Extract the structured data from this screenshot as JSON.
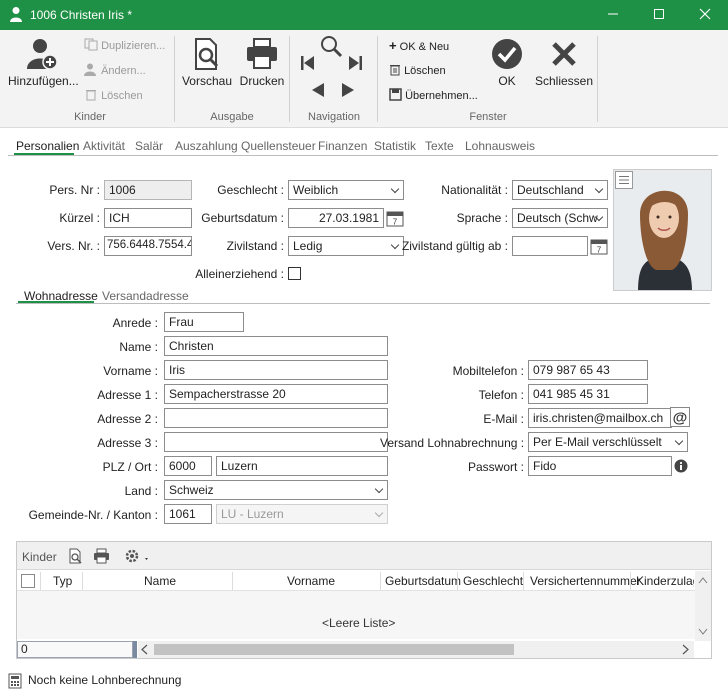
{
  "window": {
    "title": "1006 Christen Iris *"
  },
  "ribbon": {
    "kinder": {
      "add": "Hinzufügen...",
      "duplicate": "Duplizieren...",
      "change": "Ändern...",
      "delete": "Löschen",
      "group": "Kinder"
    },
    "ausgabe": {
      "preview": "Vorschau",
      "print": "Drucken",
      "group": "Ausgabe"
    },
    "navigation": {
      "group": "Navigation"
    },
    "fenster": {
      "ok_new": "OK & Neu",
      "delete": "Löschen",
      "apply": "Übernehmen...",
      "ok": "OK",
      "close": "Schliessen",
      "group": "Fenster"
    }
  },
  "tabs": [
    "Personalien",
    "Aktivität",
    "Salär",
    "Auszahlung",
    "Quellensteuer",
    "Finanzen",
    "Statistik",
    "Texte",
    "Lohnausweis"
  ],
  "personalien": {
    "pers_nr_label": "Pers. Nr :",
    "pers_nr": "1006",
    "kuerzel_label": "Kürzel :",
    "kuerzel": "ICH",
    "vers_nr_label": "Vers. Nr. :",
    "vers_nr": "756.6448.7554.4",
    "geschlecht_label": "Geschlecht :",
    "geschlecht": "Weiblich",
    "geburtsdatum_label": "Geburtsdatum :",
    "geburtsdatum": "27.03.1981",
    "zivilstand_label": "Zivilstand :",
    "zivilstand": "Ledig",
    "alleinerziehend_label": "Alleinerziehend :",
    "nationalitaet_label": "Nationalität :",
    "nationalitaet": "Deutschland",
    "sprache_label": "Sprache :",
    "sprache": "Deutsch (Schw",
    "zivilstand_ab_label": "Zivilstand gültig ab :",
    "zivilstand_ab": ""
  },
  "subtabs": [
    "Wohnadresse",
    "Versandadresse"
  ],
  "adresse": {
    "anrede_label": "Anrede :",
    "anrede": "Frau",
    "name_label": "Name :",
    "name": "Christen",
    "vorname_label": "Vorname :",
    "vorname": "Iris",
    "adresse1_label": "Adresse 1 :",
    "adresse1": "Sempacherstrasse 20",
    "adresse2_label": "Adresse 2 :",
    "adresse2": "",
    "adresse3_label": "Adresse 3 :",
    "adresse3": "",
    "plz_ort_label": "PLZ / Ort :",
    "plz": "6000",
    "ort": "Luzern",
    "land_label": "Land :",
    "land": "Schweiz",
    "gemeinde_label": "Gemeinde-Nr. / Kanton :",
    "gemeinde_nr": "1061",
    "kanton": "LU - Luzern",
    "mobil_label": "Mobiltelefon :",
    "mobil": "079 987 65 43",
    "telefon_label": "Telefon :",
    "telefon": "041 985 45 31",
    "email_label": "E-Mail :",
    "email": "iris.christen@mailbox.ch",
    "versand_label": "Versand Lohnabrechnung :",
    "versand": "Per E-Mail verschlüsselt",
    "passwort_label": "Passwort :",
    "passwort": "Fido"
  },
  "kinder_grid": {
    "title": "Kinder",
    "columns": [
      "Typ",
      "Name",
      "Vorname",
      "Geburtsdatum",
      "Geschlecht",
      "Versichertennummer",
      "Kinderzulage"
    ],
    "empty": "<Leere Liste>",
    "count": "0"
  },
  "status": {
    "text": "Noch keine Lohnberechnung"
  },
  "colors": {
    "accent": "#1f9146"
  }
}
